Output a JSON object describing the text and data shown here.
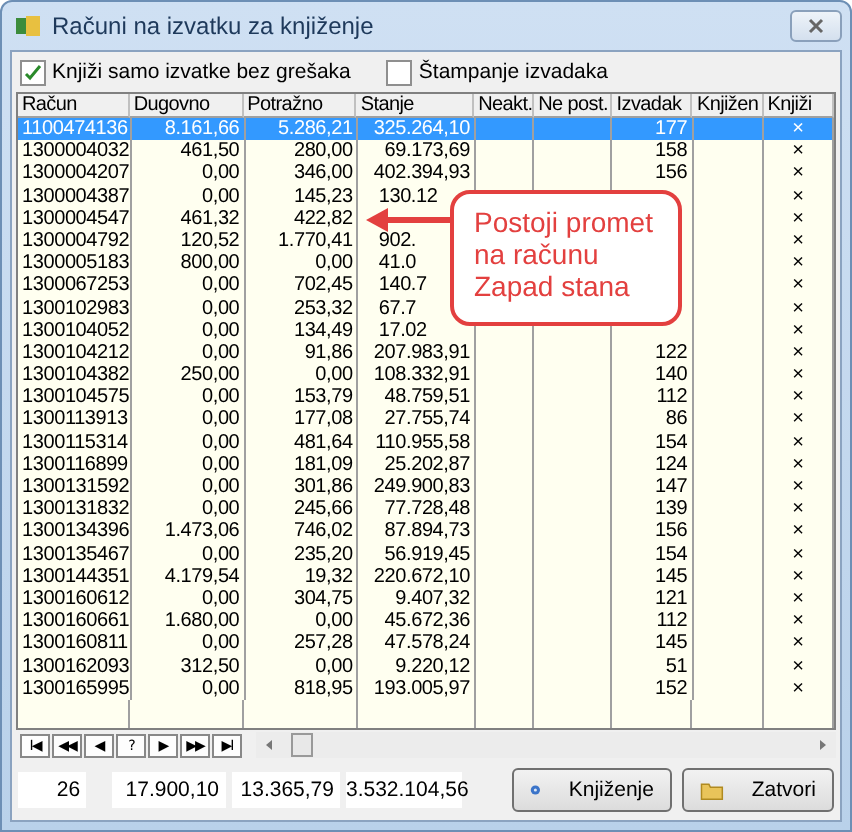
{
  "window": {
    "title": "Računi na izvatku za knjiženje"
  },
  "options": [
    {
      "label": "Knjiži samo izvatke bez grešaka",
      "checked": true
    },
    {
      "label": "Štampanje izvadaka",
      "checked": false
    }
  ],
  "table": {
    "columns": [
      "Račun",
      "Dugovno",
      "Potražno",
      "Stanje",
      "Neakt.",
      "Ne post.",
      "Izvadak",
      "Knjižen",
      "Knjiži"
    ],
    "rows": [
      {
        "racun": "1100474136",
        "dugovno": "8.161,66",
        "potrazno": "5.286,21",
        "stanje": "325.264,10",
        "izvadak": "177",
        "knjizi": "×",
        "selected": true
      },
      {
        "racun": "1300004032",
        "dugovno": "461,50",
        "potrazno": "280,00",
        "stanje": "69.173,69",
        "izvadak": "158",
        "knjizi": "×",
        "selected": false
      },
      {
        "racun": "1300004207",
        "dugovno": "0,00",
        "potrazno": "346,00",
        "stanje": "402.394,93",
        "izvadak": "156",
        "knjizi": "×",
        "selected": false
      },
      {
        "racun": "1300004387",
        "dugovno": "0,00",
        "potrazno": "145,23",
        "stanje": "130.12",
        "knjizi": "×",
        "selected": false
      },
      {
        "racun": "1300004547",
        "dugovno": "461,32",
        "potrazno": "422,82",
        "knjizi": "×",
        "selected": false
      },
      {
        "racun": "1300004792",
        "dugovno": "120,52",
        "potrazno": "1.770,41",
        "stanje": "902.",
        "knjizi": "×",
        "selected": false
      },
      {
        "racun": "1300005183",
        "dugovno": "800,00",
        "potrazno": "0,00",
        "stanje": "41.0",
        "knjizi": "×",
        "selected": false
      },
      {
        "racun": "1300067253",
        "dugovno": "0,00",
        "potrazno": "702,45",
        "stanje": "140.7",
        "knjizi": "×",
        "selected": false
      },
      {
        "racun": "1300102983",
        "dugovno": "0,00",
        "potrazno": "253,32",
        "stanje": "67.7",
        "knjizi": "×",
        "selected": false
      },
      {
        "racun": "1300104052",
        "dugovno": "0,00",
        "potrazno": "134,49",
        "stanje": "17.02",
        "knjizi": "×",
        "selected": false
      },
      {
        "racun": "1300104212",
        "dugovno": "0,00",
        "potrazno": "91,86",
        "stanje": "207.983,91",
        "izvadak": "122",
        "knjizi": "×",
        "selected": false
      },
      {
        "racun": "1300104382",
        "dugovno": "250,00",
        "potrazno": "0,00",
        "stanje": "108.332,91",
        "izvadak": "140",
        "knjizi": "×",
        "selected": false
      },
      {
        "racun": "1300104575",
        "dugovno": "0,00",
        "potrazno": "153,79",
        "stanje": "48.759,51",
        "izvadak": "112",
        "knjizi": "×",
        "selected": false
      },
      {
        "racun": "1300113913",
        "dugovno": "0,00",
        "potrazno": "177,08",
        "stanje": "27.755,74",
        "izvadak": "86",
        "knjizi": "×",
        "selected": false
      },
      {
        "racun": "1300115314",
        "dugovno": "0,00",
        "potrazno": "481,64",
        "stanje": "110.955,58",
        "izvadak": "154",
        "knjizi": "×",
        "selected": false
      },
      {
        "racun": "1300116899",
        "dugovno": "0,00",
        "potrazno": "181,09",
        "stanje": "25.202,87",
        "izvadak": "124",
        "knjizi": "×",
        "selected": false
      },
      {
        "racun": "1300131592",
        "dugovno": "0,00",
        "potrazno": "301,86",
        "stanje": "249.900,83",
        "izvadak": "147",
        "knjizi": "×",
        "selected": false
      },
      {
        "racun": "1300131832",
        "dugovno": "0,00",
        "potrazno": "245,66",
        "stanje": "77.728,48",
        "izvadak": "139",
        "knjizi": "×",
        "selected": false
      },
      {
        "racun": "1300134396",
        "dugovno": "1.473,06",
        "potrazno": "746,02",
        "stanje": "87.894,73",
        "izvadak": "156",
        "knjizi": "×",
        "selected": false
      },
      {
        "racun": "1300135467",
        "dugovno": "0,00",
        "potrazno": "235,20",
        "stanje": "56.919,45",
        "izvadak": "154",
        "knjizi": "×",
        "selected": false
      },
      {
        "racun": "1300144351",
        "dugovno": "4.179,54",
        "potrazno": "19,32",
        "stanje": "220.672,10",
        "izvadak": "145",
        "knjizi": "×",
        "selected": false
      },
      {
        "racun": "1300160612",
        "dugovno": "0,00",
        "potrazno": "304,75",
        "stanje": "9.407,32",
        "izvadak": "121",
        "knjizi": "×",
        "selected": false
      },
      {
        "racun": "1300160661",
        "dugovno": "1.680,00",
        "potrazno": "0,00",
        "stanje": "45.672,36",
        "izvadak": "112",
        "knjizi": "×",
        "selected": false
      },
      {
        "racun": "1300160811",
        "dugovno": "0,00",
        "potrazno": "257,28",
        "stanje": "47.578,24",
        "izvadak": "145",
        "knjizi": "×",
        "selected": false
      },
      {
        "racun": "1300162093",
        "dugovno": "312,50",
        "potrazno": "0,00",
        "stanje": "9.220,12",
        "izvadak": "51",
        "knjizi": "×",
        "selected": false
      },
      {
        "racun": "1300165995",
        "dugovno": "0,00",
        "potrazno": "818,95",
        "stanje": "193.005,97",
        "izvadak": "152",
        "knjizi": "×",
        "selected": false
      }
    ]
  },
  "callout": {
    "text": "Postoji promet na računu Zapad stana"
  },
  "navigator": [
    "I◀",
    "◀◀",
    "◀",
    "?",
    "▶",
    "▶▶",
    "▶I"
  ],
  "totals": [
    "26",
    "17.900,10",
    "13.365,79",
    "3.532.104,56"
  ],
  "buttons": [
    {
      "label": "Knjiženje",
      "kind": "post"
    },
    {
      "label": "Zatvori",
      "kind": "close"
    }
  ]
}
